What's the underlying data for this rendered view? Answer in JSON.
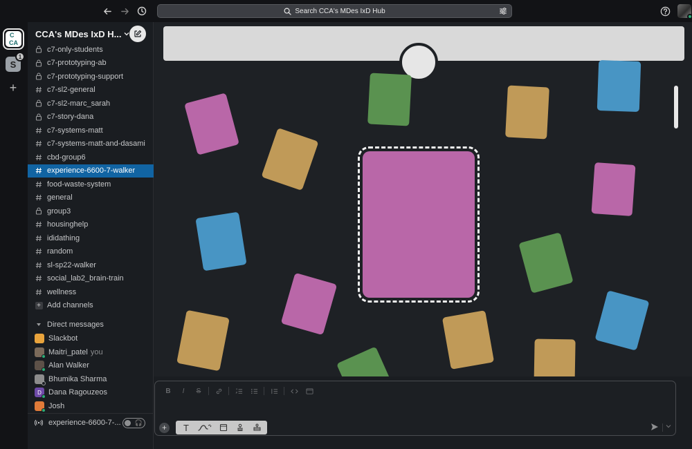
{
  "top_bar": {
    "search_placeholder": "Search CCA's MDes IxD Hub",
    "back_icon": "arrow-left-icon",
    "forward_icon": "arrow-right-icon",
    "history_icon": "clock-icon",
    "help_icon": "help-circle-icon"
  },
  "rail": {
    "workspace_logo_text": [
      "C",
      "CA"
    ],
    "second_workspace_letter": "S",
    "second_workspace_badge": "1",
    "add_workspace": "+"
  },
  "sidebar": {
    "workspace_name": "CCA's MDes IxD H...",
    "channels": [
      {
        "name": "c7-only-students",
        "type": "private"
      },
      {
        "name": "c7-prototyping-ab",
        "type": "private"
      },
      {
        "name": "c7-prototyping-support",
        "type": "private"
      },
      {
        "name": "c7-sl2-general",
        "type": "public"
      },
      {
        "name": "c7-sl2-marc_sarah",
        "type": "private"
      },
      {
        "name": "c7-story-dana",
        "type": "private"
      },
      {
        "name": "c7-systems-matt",
        "type": "public"
      },
      {
        "name": "c7-systems-matt-and-dasami",
        "type": "public"
      },
      {
        "name": "cbd-group6",
        "type": "public"
      },
      {
        "name": "experience-6600-7-walker",
        "type": "public",
        "active": true
      },
      {
        "name": "food-waste-system",
        "type": "public"
      },
      {
        "name": "general",
        "type": "public"
      },
      {
        "name": "group3",
        "type": "private"
      },
      {
        "name": "housinghelp",
        "type": "public"
      },
      {
        "name": "ididathing",
        "type": "public"
      },
      {
        "name": "random",
        "type": "public"
      },
      {
        "name": "sl-sp22-walker",
        "type": "public"
      },
      {
        "name": "social_lab2_brain-train",
        "type": "public"
      },
      {
        "name": "wellness",
        "type": "public"
      }
    ],
    "add_channels": "Add channels",
    "dm_header": "Direct messages",
    "dms": [
      {
        "name": "Slackbot",
        "you": "",
        "color": "#e8a33c"
      },
      {
        "name": "Maitri_patel",
        "you": "you",
        "color": "#7a6a5a"
      },
      {
        "name": "Alan Walker",
        "you": "",
        "color": "#5d5148"
      },
      {
        "name": "Bhumika Sharma",
        "you": "",
        "color": "#8c8c8c"
      },
      {
        "name": "Dana Ragouzeos",
        "you": "",
        "color": "#6e4aa8",
        "initial": "D"
      },
      {
        "name": "Josh",
        "you": "",
        "color": "#e07b39"
      }
    ],
    "huddle_label": "experience-6600-7-...",
    "huddle_toggle_icon": "headphones-icon"
  },
  "composer": {
    "format_buttons": [
      "B",
      "I",
      "S",
      "link",
      "ordered-list",
      "bulleted-list",
      "block-list",
      "code",
      "code-block"
    ],
    "tool_icons": [
      "text-tool-icon",
      "draw-tool-icon",
      "sticky-note-icon",
      "stamp-icon",
      "stamp-pad-icon"
    ],
    "text_tool_label": "T",
    "send_icon": "send-icon"
  },
  "colors": {
    "pink": "#b967a8",
    "tan": "#c09a58",
    "green": "#5a9250",
    "blue": "#4895c4",
    "active_channel": "#1164a3"
  }
}
